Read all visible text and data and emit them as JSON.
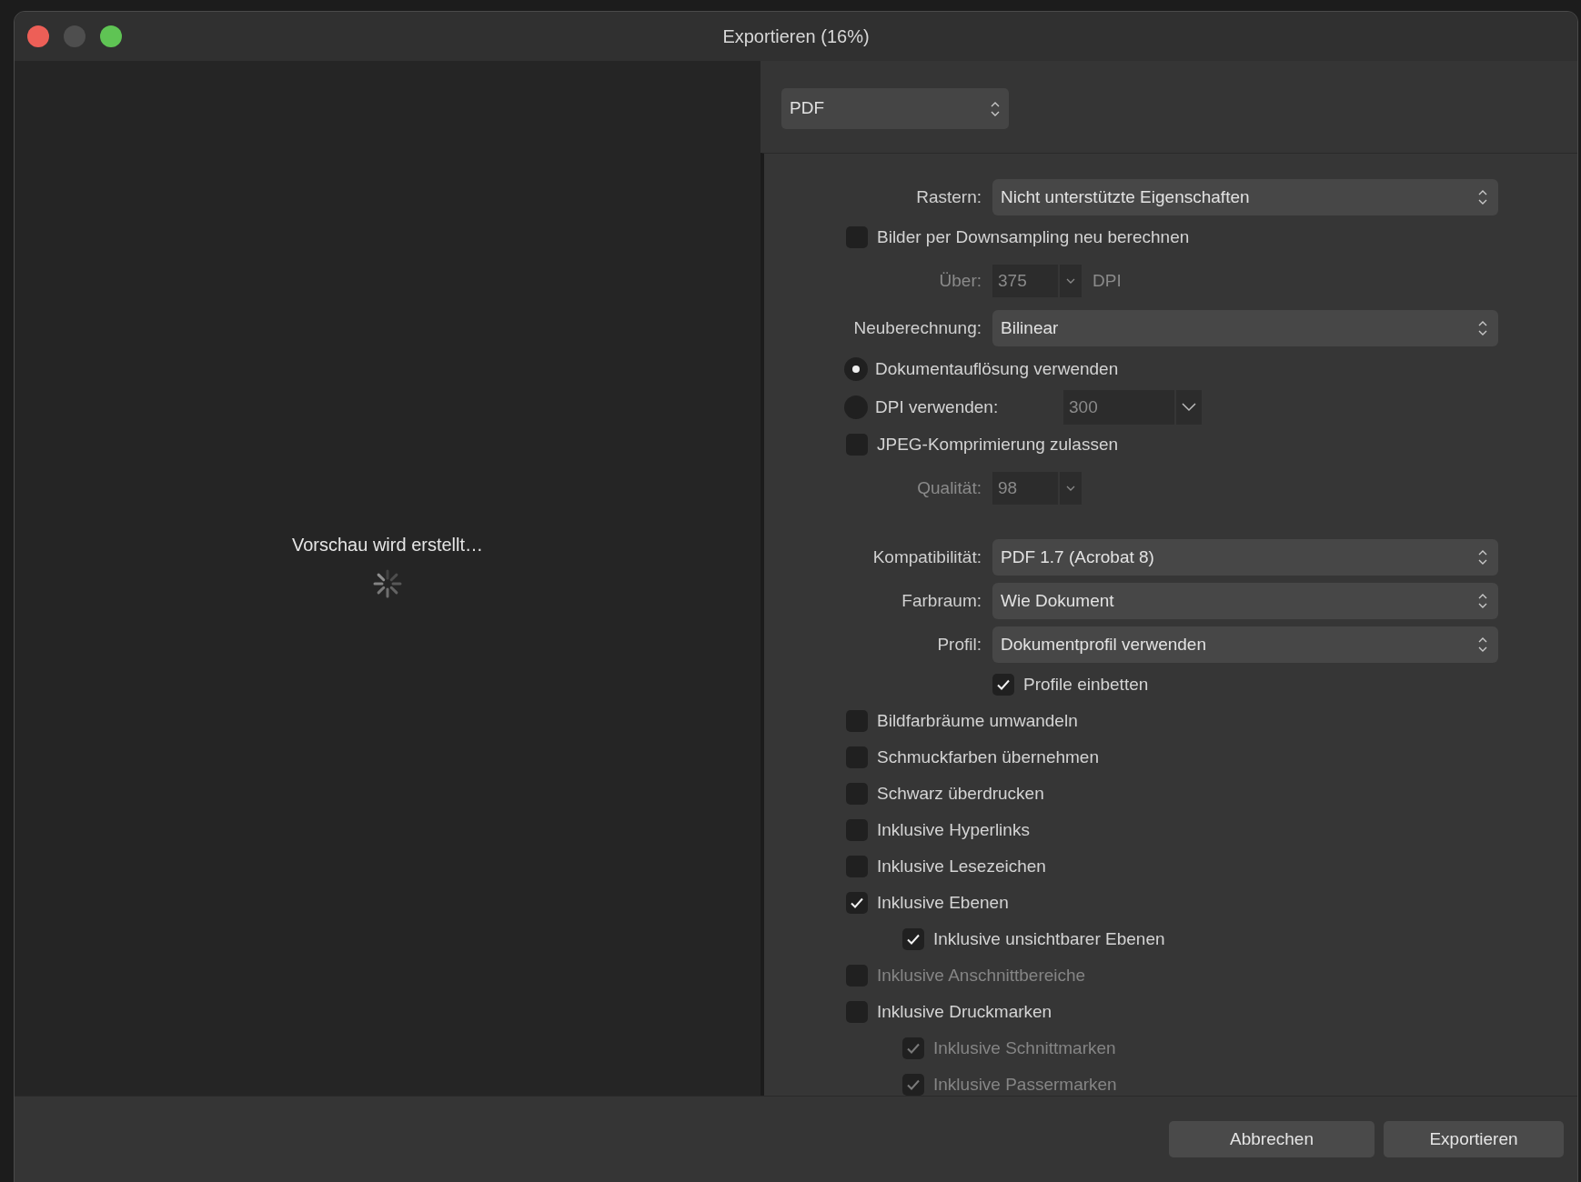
{
  "window": {
    "title": "Exportieren (16%)"
  },
  "preview": {
    "message": "Vorschau wird erstellt…"
  },
  "format": {
    "value": "PDF"
  },
  "settings": [
    {
      "kind": "select",
      "label": "Rastern:",
      "value": "Nicht unterstützte Eigenschaften"
    },
    {
      "kind": "checkbox",
      "label": "Bilder per Downsampling neu berechnen",
      "checked": false,
      "disabled": false
    },
    {
      "kind": "number",
      "label": "Über:",
      "value": "375",
      "unit": "DPI",
      "disabled": true
    },
    {
      "kind": "select",
      "label": "Neuberechnung:",
      "value": "Bilinear"
    },
    {
      "kind": "radio",
      "label": "Dokumentauflösung verwenden",
      "selected": true
    },
    {
      "kind": "radio",
      "label": "DPI verwenden:",
      "selected": false,
      "field": {
        "value": "300",
        "disabled": true
      }
    },
    {
      "kind": "checkbox",
      "label": "JPEG-Komprimierung zulassen",
      "checked": false,
      "disabled": false
    },
    {
      "kind": "number",
      "label": "Qualität:",
      "value": "98",
      "disabled": true
    },
    {
      "kind": "select",
      "label": "Kompatibilität:",
      "value": "PDF 1.7 (Acrobat 8)"
    },
    {
      "kind": "select",
      "label": "Farbraum:",
      "value": "Wie Dokument"
    },
    {
      "kind": "select",
      "label": "Profil:",
      "value": "Dokumentprofil verwenden",
      "children": [
        {
          "label": "Profile einbetten",
          "checked": true,
          "disabled": false
        }
      ]
    },
    {
      "kind": "checkbox",
      "label": "Bildfarbräume umwandeln",
      "checked": false,
      "disabled": false
    },
    {
      "kind": "checkbox",
      "label": "Schmuckfarben übernehmen",
      "checked": false,
      "disabled": false
    },
    {
      "kind": "checkbox",
      "label": "Schwarz überdrucken",
      "checked": false,
      "disabled": false
    },
    {
      "kind": "checkbox",
      "label": "Inklusive Hyperlinks",
      "checked": false,
      "disabled": false
    },
    {
      "kind": "checkbox",
      "label": "Inklusive Lesezeichen",
      "checked": false,
      "disabled": false
    },
    {
      "kind": "checkbox",
      "label": "Inklusive Ebenen",
      "checked": true,
      "disabled": false,
      "children": [
        {
          "label": "Inklusive unsichtbarer Ebenen",
          "checked": true,
          "disabled": false
        }
      ]
    },
    {
      "kind": "checkbox",
      "label": "Inklusive Anschnittbereiche",
      "checked": false,
      "disabled": true
    },
    {
      "kind": "checkbox",
      "label": "Inklusive Druckmarken",
      "checked": false,
      "disabled": false,
      "children": [
        {
          "label": "Inklusive Schnittmarken",
          "checked": true,
          "disabled": true
        },
        {
          "label": "Inklusive Passermarken",
          "checked": true,
          "disabled": true
        }
      ]
    }
  ],
  "buttons": [
    {
      "label": "Abbrechen"
    },
    {
      "label": "Exportieren"
    }
  ]
}
